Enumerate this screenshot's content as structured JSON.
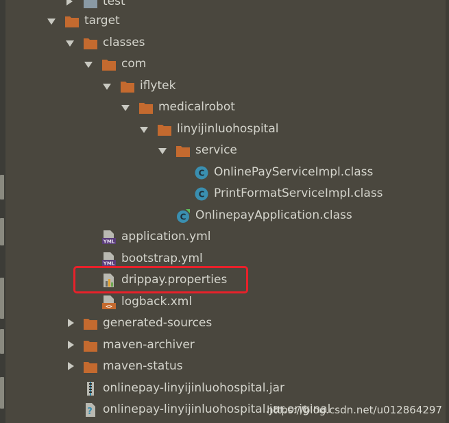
{
  "tree": {
    "items": [
      {
        "label": "test",
        "icon": "folder-icon",
        "arrow": "collapsed"
      },
      {
        "label": "target",
        "icon": "folder-icon",
        "arrow": "expanded"
      },
      {
        "label": "classes",
        "icon": "folder-icon",
        "arrow": "expanded"
      },
      {
        "label": "com",
        "icon": "folder-icon",
        "arrow": "expanded"
      },
      {
        "label": "iflytek",
        "icon": "folder-icon",
        "arrow": "expanded"
      },
      {
        "label": "medicalrobot",
        "icon": "folder-icon",
        "arrow": "expanded"
      },
      {
        "label": "linyijinluohospital",
        "icon": "folder-icon",
        "arrow": "expanded"
      },
      {
        "label": "service",
        "icon": "folder-icon",
        "arrow": "expanded"
      },
      {
        "label": "OnlinePayServiceImpl.class",
        "icon": "class-icon",
        "arrow": "none"
      },
      {
        "label": "PrintFormatServiceImpl.class",
        "icon": "class-icon",
        "arrow": "none"
      },
      {
        "label": "OnlinepayApplication.class",
        "icon": "spring-class-icon",
        "arrow": "none"
      },
      {
        "label": "application.yml",
        "icon": "yml-file-icon",
        "arrow": "none"
      },
      {
        "label": "bootstrap.yml",
        "icon": "yml-file-icon",
        "arrow": "none"
      },
      {
        "label": "drippay.properties",
        "icon": "properties-file-icon",
        "arrow": "none"
      },
      {
        "label": "logback.xml",
        "icon": "xml-file-icon",
        "arrow": "none"
      },
      {
        "label": "generated-sources",
        "icon": "folder-icon",
        "arrow": "collapsed"
      },
      {
        "label": "maven-archiver",
        "icon": "folder-icon",
        "arrow": "collapsed"
      },
      {
        "label": "maven-status",
        "icon": "folder-icon",
        "arrow": "collapsed"
      },
      {
        "label": "onlinepay-linyijinluohospital.jar",
        "icon": "jar-file-icon",
        "arrow": "none"
      },
      {
        "label": "onlinepay-linyijinluohospital.jar.original",
        "icon": "unknown-file-icon",
        "arrow": "none"
      }
    ]
  },
  "watermark": "https://blog.csdn.net/u012864297",
  "colors": {
    "background": "#4a473e",
    "folder": "#c46a2f",
    "class_icon": "#3a8fb0",
    "highlight": "#e8212a",
    "text": "#d4d4cc"
  }
}
